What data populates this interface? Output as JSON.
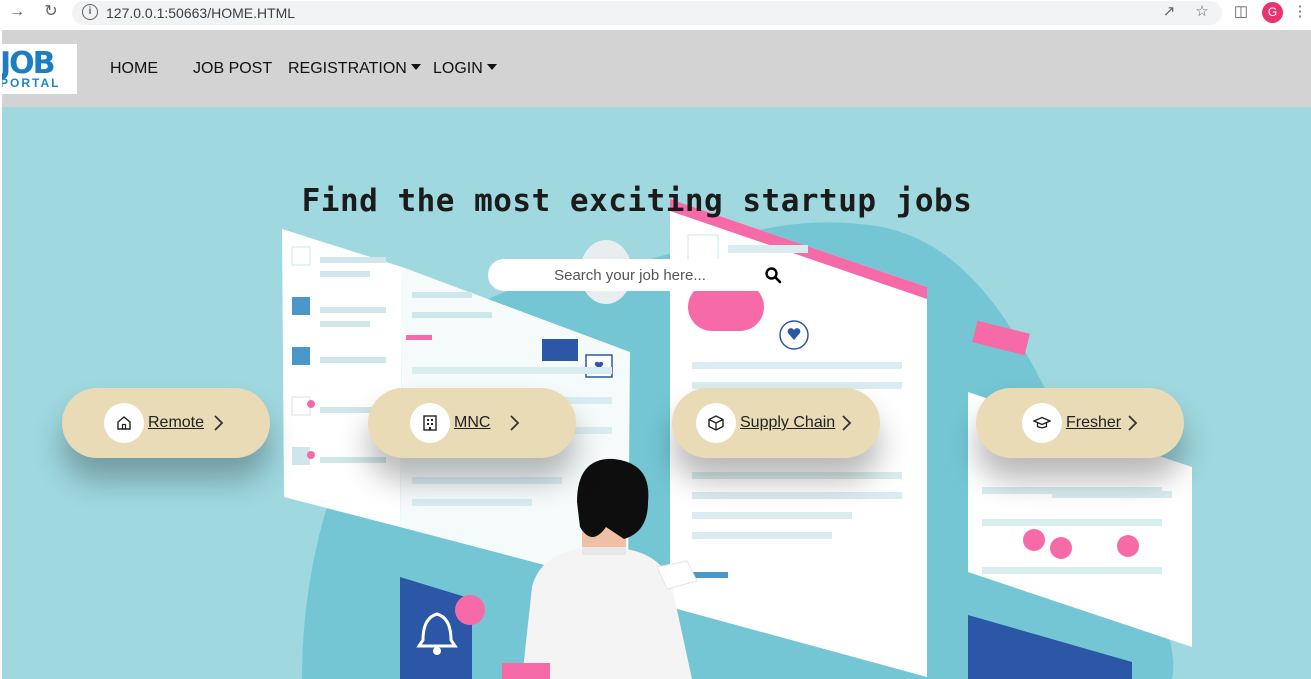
{
  "browser": {
    "url": "127.0.0.1:50663/HOME.HTML",
    "profile_initial": "G"
  },
  "navbar": {
    "logo_top": "JOB",
    "logo_bottom": "PORTAL",
    "links": [
      {
        "label": "HOME",
        "has_caret": false
      },
      {
        "label": "JOB POST",
        "has_caret": false
      },
      {
        "label": "REGISTRATION",
        "has_caret": true
      },
      {
        "label": "LOGIN",
        "has_caret": true
      }
    ]
  },
  "hero": {
    "title": "Find the most exciting startup jobs",
    "search": {
      "placeholder": "Search your job here..."
    },
    "categories": [
      {
        "label": "Remote",
        "icon": "home-icon"
      },
      {
        "label": "MNC",
        "icon": "building-icon"
      },
      {
        "label": "Supply Chain",
        "icon": "box-icon"
      },
      {
        "label": "Fresher",
        "icon": "graduation-cap-icon"
      }
    ]
  },
  "colors": {
    "hero_bg": "#9fd8df",
    "navbar_bg": "#d3d3d3",
    "pill_bg": "#e8dbb5",
    "accent_pink": "#f76aa8",
    "accent_blue": "#2c57a6"
  }
}
